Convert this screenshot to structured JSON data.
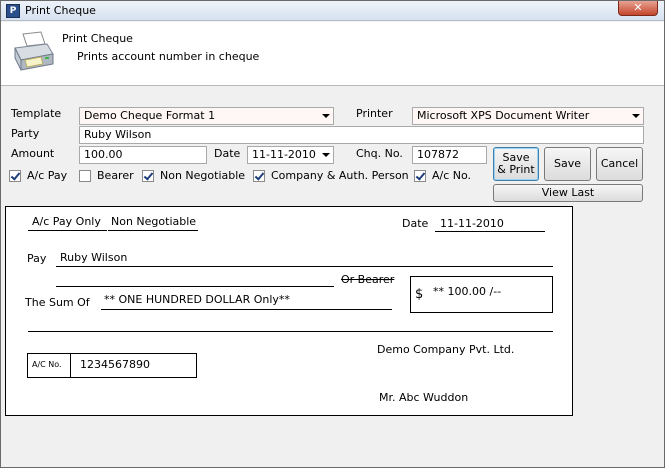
{
  "window": {
    "title": "Print Cheque",
    "close_glyph": "✕",
    "app_icon_text": "P"
  },
  "header": {
    "title": "Print Cheque",
    "subtitle": "Prints account number in cheque"
  },
  "form": {
    "template_label": "Template",
    "template_value": "Demo Cheque Format 1",
    "printer_label": "Printer",
    "printer_value": "Microsoft XPS Document Writer",
    "party_label": "Party",
    "party_value": "Ruby Wilson",
    "amount_label": "Amount",
    "amount_value": "100.00",
    "date_label": "Date",
    "date_value": "11-11-2010",
    "chq_no_label": "Chq. No.",
    "chq_no_value": "107872"
  },
  "checkboxes": [
    {
      "label": "A/c Pay",
      "checked": true
    },
    {
      "label": "Bearer",
      "checked": false
    },
    {
      "label": "Non Negotiable",
      "checked": true
    },
    {
      "label": "Company & Auth. Person",
      "checked": true
    },
    {
      "label": "A/c No.",
      "checked": true
    }
  ],
  "buttons": {
    "save_print_line1": "Save",
    "save_print_line2": "& Print",
    "save": "Save",
    "cancel": "Cancel",
    "view_last": "View Last"
  },
  "cheque": {
    "ac_pay_only": "A/c Pay Only",
    "non_negotiable": "Non Negotiable",
    "date_label": "Date",
    "date_value": "11-11-2010",
    "pay_label": "Pay",
    "payee": "Ruby Wilson",
    "or_bearer": "Or Bearer",
    "sum_label": "The Sum Of",
    "sum_words": "** ONE HUNDRED  DOLLAR Only**",
    "currency": "$",
    "amount_box": "** 100.00 /--",
    "company": "Demo Company Pvt. Ltd.",
    "ac_no_label": "A/C No.",
    "ac_no_value": "1234567890",
    "signatory": "Mr. Abc Wuddon"
  },
  "icons": {
    "header_icon": "printer-icon",
    "dropdown": "chevron-down-icon"
  }
}
